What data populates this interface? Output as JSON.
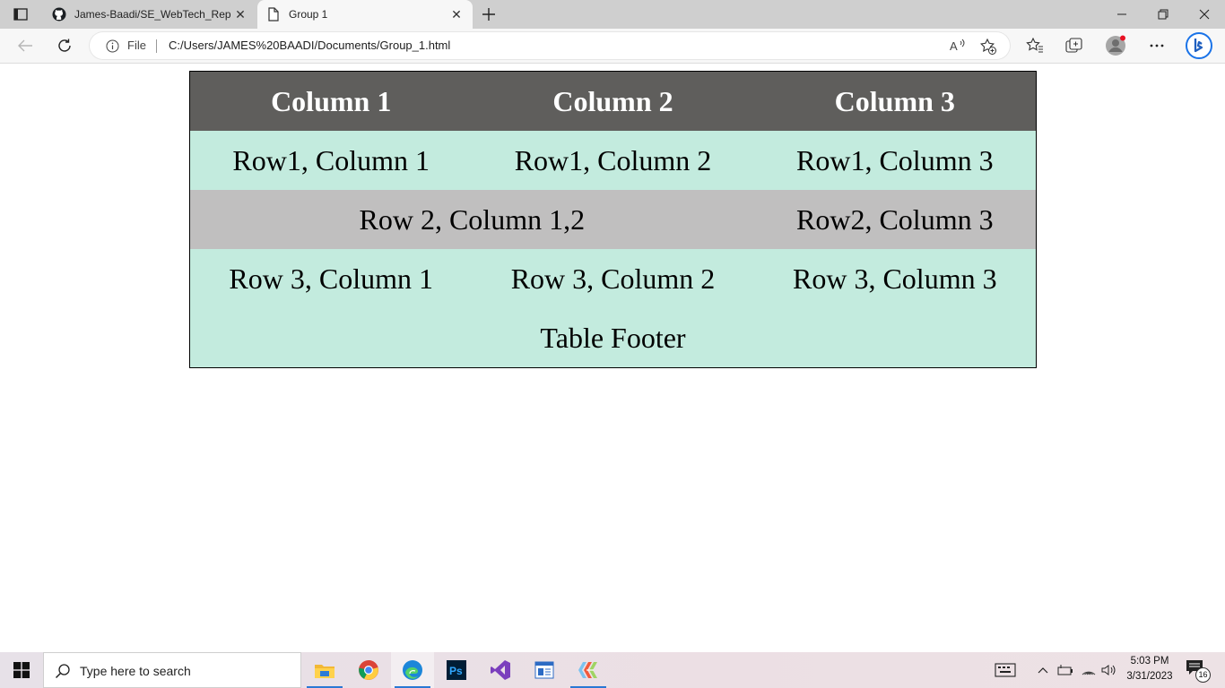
{
  "browser": {
    "tabs": [
      {
        "title": "James-Baadi/SE_WebTech_Repo:",
        "active": false
      },
      {
        "title": "Group 1",
        "active": true
      }
    ],
    "address": {
      "scheme_label": "File",
      "url": "C:/Users/JAMES%20BAADI/Documents/Group_1.html"
    }
  },
  "page": {
    "table": {
      "header": [
        "Column 1",
        "Column 2",
        "Column 3"
      ],
      "row1": [
        "Row1, Column 1",
        "Row1, Column 2",
        "Row1, Column 3"
      ],
      "row2": [
        "Row 2, Column 1,2",
        "Row2, Column 3"
      ],
      "row3": [
        "Row 3, Column 1",
        "Row 3, Column 2",
        "Row 3, Column 3"
      ],
      "footer": "Table Footer"
    },
    "colors": {
      "header_bg": "#5f5e5c",
      "row_green": "#c3ebde",
      "row_gray": "#c0bfbf"
    }
  },
  "taskbar": {
    "search_placeholder": "Type here to search",
    "apps": [
      "file-explorer",
      "chrome",
      "edge",
      "photoshop",
      "visual-studio",
      "app",
      "git"
    ],
    "time": "5:03 PM",
    "date": "3/31/2023",
    "notification_count": "16"
  }
}
